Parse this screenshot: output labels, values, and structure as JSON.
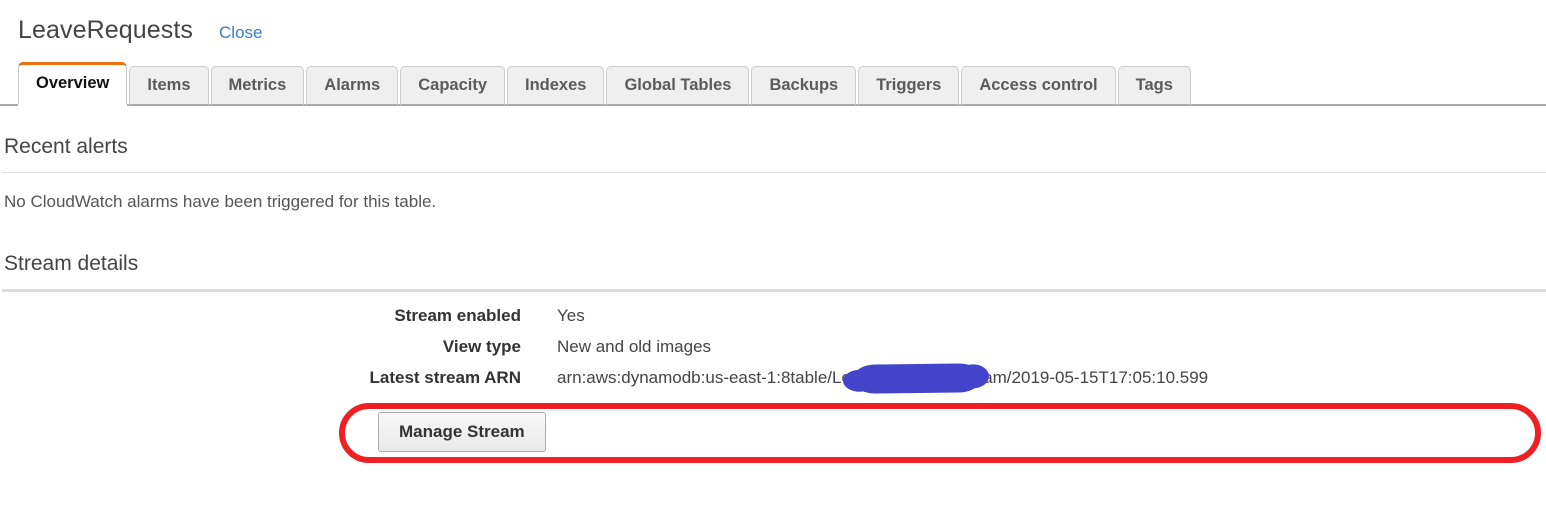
{
  "header": {
    "table_name": "LeaveRequests",
    "close_label": "Close"
  },
  "tabs": [
    {
      "label": "Overview",
      "active": true
    },
    {
      "label": "Items",
      "active": false
    },
    {
      "label": "Metrics",
      "active": false
    },
    {
      "label": "Alarms",
      "active": false
    },
    {
      "label": "Capacity",
      "active": false
    },
    {
      "label": "Indexes",
      "active": false
    },
    {
      "label": "Global Tables",
      "active": false
    },
    {
      "label": "Backups",
      "active": false
    },
    {
      "label": "Triggers",
      "active": false
    },
    {
      "label": "Access control",
      "active": false
    },
    {
      "label": "Tags",
      "active": false
    }
  ],
  "recent_alerts": {
    "title": "Recent alerts",
    "message": "No CloudWatch alarms have been triggered for this table."
  },
  "stream_details": {
    "title": "Stream details",
    "rows": [
      {
        "label": "Stream enabled",
        "value": "Yes"
      },
      {
        "label": "View type",
        "value": "New and old images"
      }
    ],
    "arn_row": {
      "label": "Latest stream ARN",
      "value_prefix": "arn:aws:dynamodb:us-east-1:8",
      "value_suffix": "table/LeaveRequests/stream/2019-05-15T17:05:10.599",
      "redacted": true
    },
    "manage_button_label": "Manage Stream"
  },
  "annotations": {
    "oval_color": "#ee2024",
    "oval_stroke_width": 6,
    "redaction_color": "#4343cc"
  },
  "colors": {
    "active_tab_accent": "#ec7211",
    "link": "#3b7dbf",
    "tab_inactive_bg": "#efefef",
    "text": "#333333",
    "divider": "#e0e0e0"
  }
}
